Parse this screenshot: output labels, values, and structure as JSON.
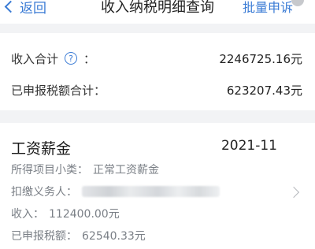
{
  "nav": {
    "back_label": "返回",
    "title": "收入纳税明细查询",
    "batch_label": "批量申诉"
  },
  "summary": {
    "income_label": "收入合计",
    "income_colon": "：",
    "income_value": "2246725.16元",
    "tax_label": "已申报税额合计：",
    "tax_value": "623207.43元"
  },
  "record": {
    "title": "工资薪金",
    "period": "2021-11",
    "subcat_label": "所得项目小类：",
    "subcat_value": "正常工资薪金",
    "withholder_label": "扣缴义务人：",
    "income_label": "收入：",
    "income_value": "112400.00元",
    "tax_label": "已申报税额：",
    "tax_value": "62540.33元"
  },
  "icons": {
    "help": "?"
  },
  "colors": {
    "accent": "#3a7bd5",
    "muted": "#7a7f86",
    "background": "#f2f3f5"
  }
}
